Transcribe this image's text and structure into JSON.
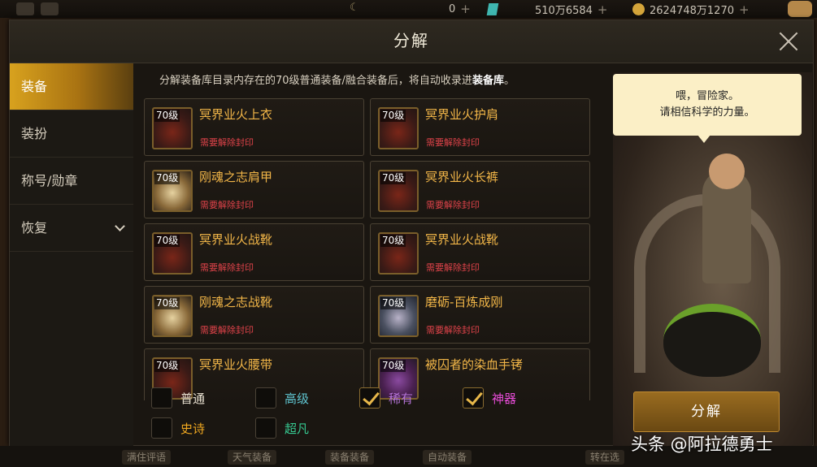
{
  "topbar": {
    "currency_1": "0",
    "currency_2": "510万6584",
    "currency_3": "2624748万1270",
    "plus": "+"
  },
  "window": {
    "title": "分解"
  },
  "sidebar": {
    "items": [
      {
        "label": "装备"
      },
      {
        "label": "装扮"
      },
      {
        "label": "称号/勋章"
      },
      {
        "label": "恢复"
      }
    ]
  },
  "notice": {
    "text": "分解装备库目录内存在的70级普通装备/融合装备后，将自动收录进",
    "bold": "装备库",
    "end": "。"
  },
  "items": [
    {
      "level": "70级",
      "name": "冥界业火上衣",
      "status": "需要解除封印",
      "icon": "red-armor-icon"
    },
    {
      "level": "70级",
      "name": "冥界业火护肩",
      "status": "需要解除封印",
      "icon": "red-armor-icon"
    },
    {
      "level": "70级",
      "name": "刚魂之志肩甲",
      "status": "需要解除封印",
      "icon": "gold-armor-icon"
    },
    {
      "level": "70级",
      "name": "冥界业火长裤",
      "status": "需要解除封印",
      "icon": "red-armor-icon"
    },
    {
      "level": "70级",
      "name": "冥界业火战靴",
      "status": "需要解除封印",
      "icon": "red-armor-icon"
    },
    {
      "level": "70级",
      "name": "冥界业火战靴",
      "status": "需要解除封印",
      "icon": "red-armor-icon"
    },
    {
      "level": "70级",
      "name": "刚魂之志战靴",
      "status": "需要解除封印",
      "icon": "gold-armor-icon"
    },
    {
      "level": "70级",
      "name": "磨砺-百炼成刚",
      "status": "需要解除封印",
      "icon": "blue-armor-icon"
    },
    {
      "level": "70级",
      "name": "冥界业火腰带",
      "status": "",
      "icon": "red-armor-icon"
    },
    {
      "level": "70级",
      "name": "被囚者的染血手铐",
      "status": "",
      "icon": "purple-armor-icon"
    }
  ],
  "filters": [
    {
      "label": "普通",
      "checked": false,
      "color": "#e8e0d0"
    },
    {
      "label": "高级",
      "checked": false,
      "color": "#5fc4d0"
    },
    {
      "label": "稀有",
      "checked": true,
      "color": "#b574d8"
    },
    {
      "label": "神器",
      "checked": true,
      "color": "#e84cd8"
    },
    {
      "label": "史诗",
      "checked": false,
      "color": "#f0a820"
    },
    {
      "label": "超凡",
      "checked": false,
      "color": "#36c890"
    }
  ],
  "npc": {
    "line1": "喂，冒险家。",
    "line2": "请相信科学的力量。"
  },
  "actions": {
    "decompose_label": "分解"
  },
  "watermark": "头条 @阿拉德勇士",
  "bottom": {
    "btn1": "满住评语",
    "btn2": "天气装备",
    "btn3": "装备装备",
    "btn4": "自动装备",
    "btn5": "转在选"
  }
}
